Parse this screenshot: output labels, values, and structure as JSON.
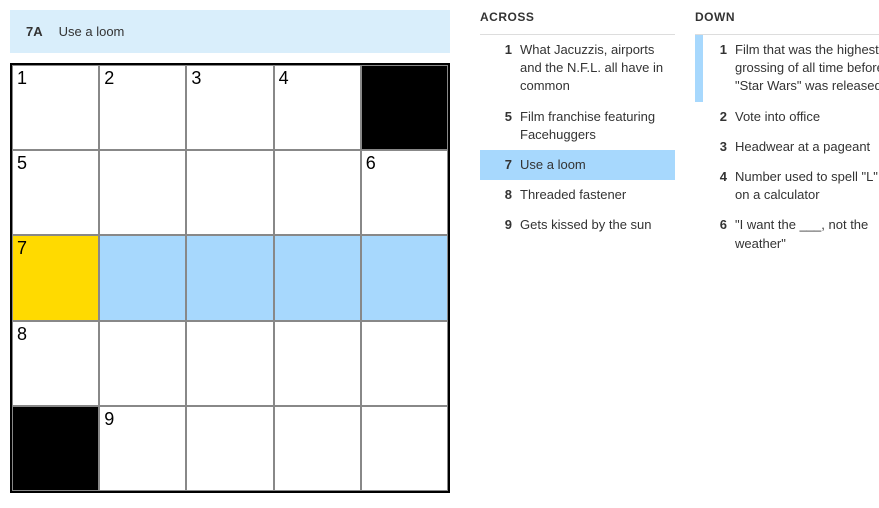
{
  "current_clue": {
    "label": "7A",
    "text": "Use a loom"
  },
  "grid": {
    "rows": 5,
    "cols": 5,
    "cells": [
      {
        "r": 0,
        "c": 0,
        "num": "1",
        "state": "normal"
      },
      {
        "r": 0,
        "c": 1,
        "num": "2",
        "state": "normal"
      },
      {
        "r": 0,
        "c": 2,
        "num": "3",
        "state": "normal"
      },
      {
        "r": 0,
        "c": 3,
        "num": "4",
        "state": "normal"
      },
      {
        "r": 0,
        "c": 4,
        "num": "",
        "state": "black"
      },
      {
        "r": 1,
        "c": 0,
        "num": "5",
        "state": "normal"
      },
      {
        "r": 1,
        "c": 1,
        "num": "",
        "state": "normal"
      },
      {
        "r": 1,
        "c": 2,
        "num": "",
        "state": "normal"
      },
      {
        "r": 1,
        "c": 3,
        "num": "",
        "state": "normal"
      },
      {
        "r": 1,
        "c": 4,
        "num": "6",
        "state": "normal"
      },
      {
        "r": 2,
        "c": 0,
        "num": "7",
        "state": "active"
      },
      {
        "r": 2,
        "c": 1,
        "num": "",
        "state": "highlight"
      },
      {
        "r": 2,
        "c": 2,
        "num": "",
        "state": "highlight"
      },
      {
        "r": 2,
        "c": 3,
        "num": "",
        "state": "highlight"
      },
      {
        "r": 2,
        "c": 4,
        "num": "",
        "state": "highlight"
      },
      {
        "r": 3,
        "c": 0,
        "num": "8",
        "state": "normal"
      },
      {
        "r": 3,
        "c": 1,
        "num": "",
        "state": "normal"
      },
      {
        "r": 3,
        "c": 2,
        "num": "",
        "state": "normal"
      },
      {
        "r": 3,
        "c": 3,
        "num": "",
        "state": "normal"
      },
      {
        "r": 3,
        "c": 4,
        "num": "",
        "state": "normal"
      },
      {
        "r": 4,
        "c": 0,
        "num": "",
        "state": "black"
      },
      {
        "r": 4,
        "c": 1,
        "num": "9",
        "state": "normal"
      },
      {
        "r": 4,
        "c": 2,
        "num": "",
        "state": "normal"
      },
      {
        "r": 4,
        "c": 3,
        "num": "",
        "state": "normal"
      },
      {
        "r": 4,
        "c": 4,
        "num": "",
        "state": "normal"
      }
    ]
  },
  "clues": {
    "across": {
      "header": "ACROSS",
      "items": [
        {
          "num": "1",
          "text": "What Jacuzzis, airports and the N.F.L. all have in common",
          "selected": false,
          "related": false
        },
        {
          "num": "5",
          "text": "Film franchise featuring Facehuggers",
          "selected": false,
          "related": false
        },
        {
          "num": "7",
          "text": "Use a loom",
          "selected": true,
          "related": false
        },
        {
          "num": "8",
          "text": "Threaded fastener",
          "selected": false,
          "related": false
        },
        {
          "num": "9",
          "text": "Gets kissed by the sun",
          "selected": false,
          "related": false
        }
      ]
    },
    "down": {
      "header": "DOWN",
      "items": [
        {
          "num": "1",
          "text": "Film that was the highest-grossing of all time before \"Star Wars\" was released",
          "selected": false,
          "related": true
        },
        {
          "num": "2",
          "text": "Vote into office",
          "selected": false,
          "related": false
        },
        {
          "num": "3",
          "text": "Headwear at a pageant",
          "selected": false,
          "related": false
        },
        {
          "num": "4",
          "text": "Number used to spell \"L\" on a calculator",
          "selected": false,
          "related": false
        },
        {
          "num": "6",
          "text": "\"I want the ___, not the weather\"",
          "selected": false,
          "related": false
        }
      ]
    }
  }
}
